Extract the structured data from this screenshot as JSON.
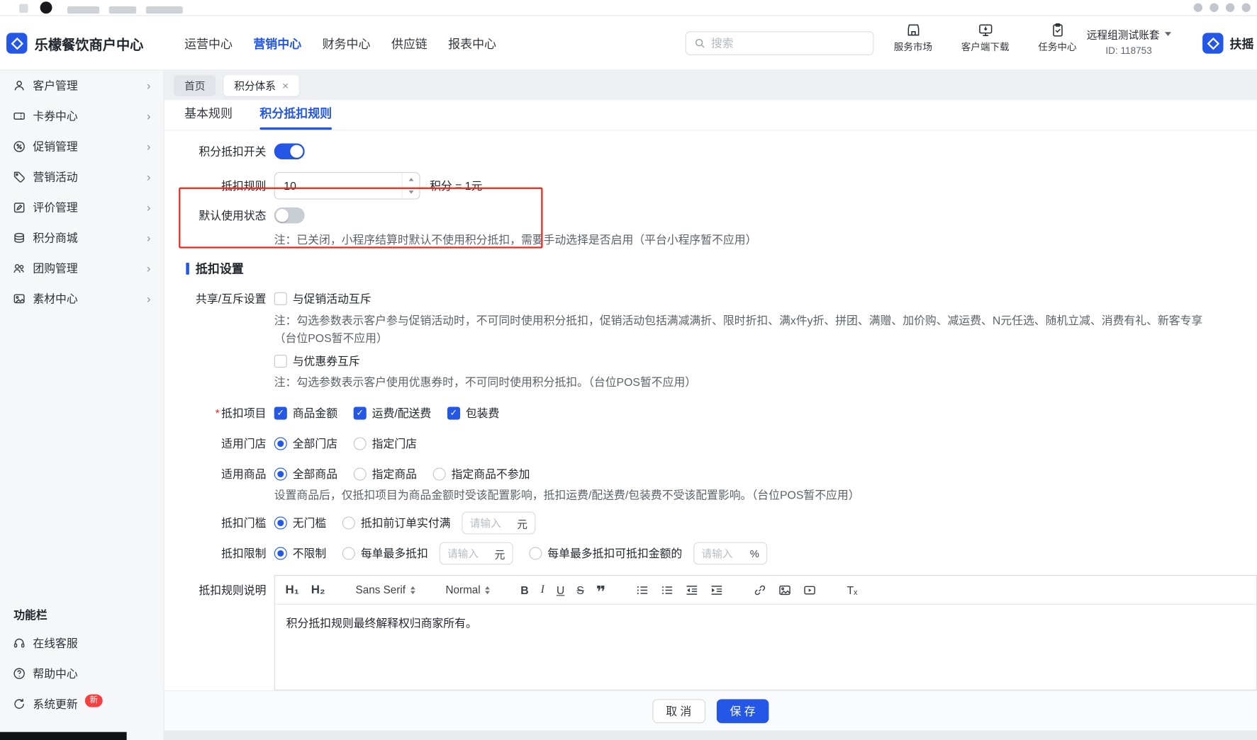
{
  "glyphs": {
    "chevron_right": "›",
    "check": "✓"
  },
  "header": {
    "logo": "乐檬餐饮商户中心",
    "nav": [
      {
        "label": "运营中心"
      },
      {
        "label": "营销中心"
      },
      {
        "label": "财务中心"
      },
      {
        "label": "供应链"
      },
      {
        "label": "报表中心"
      }
    ],
    "search_placeholder": "搜索",
    "actions": [
      {
        "label": "服务市场"
      },
      {
        "label": "客户端下载"
      },
      {
        "label": "任务中心"
      }
    ],
    "account_name": "远程组测试账套",
    "account_id": "ID: 118753",
    "user_name": "扶摇"
  },
  "sidebar": {
    "items": [
      {
        "label": "客户管理"
      },
      {
        "label": "卡券中心"
      },
      {
        "label": "促销管理"
      },
      {
        "label": "营销活动"
      },
      {
        "label": "评价管理"
      },
      {
        "label": "积分商城"
      },
      {
        "label": "团购管理"
      },
      {
        "label": "素材中心"
      }
    ],
    "section": "功能栏",
    "footer_items": [
      {
        "label": "在线客服"
      },
      {
        "label": "帮助中心"
      },
      {
        "label": "系统更新",
        "badge": "新"
      }
    ]
  },
  "tabs_row": {
    "home": "首页",
    "active": "积分体系",
    "close": "×"
  },
  "page_tabs": [
    {
      "label": "基本规则"
    },
    {
      "label": "积分抵扣规则"
    }
  ],
  "form": {
    "switch_label": "积分抵扣开关",
    "rule_label": "抵扣规则",
    "rule_value": "10",
    "rule_suffix": "积分 = 1元",
    "default_label": "默认使用状态",
    "default_note": "注：已关闭，小程序结算时默认不使用积分抵扣，需要手动选择是否启用（平台小程序暂不应用）",
    "section_title": "抵扣设置",
    "share_label": "共享/互斥设置",
    "promo_option": "与促销活动互斥",
    "promo_note": "注：勾选参数表示客户参与促销活动时，不可同时使用积分抵扣，促销活动包括满减满折、限时折扣、满x件y折、拼团、满赠、加价购、减运费、N元任选、随机立减、消费有礼、新客专享",
    "promo_note2": "（台位POS暂不应用）",
    "coupon_option": "与优惠券互斥",
    "coupon_note": "注：勾选参数表示客户使用优惠券时，不可同时使用积分抵扣。（台位POS暂不应用）",
    "items_label": "抵扣项目",
    "items_required": "*",
    "item_options": [
      {
        "label": "商品金额"
      },
      {
        "label": "运费/配送费"
      },
      {
        "label": "包装费"
      }
    ],
    "stores_label": "适用门店",
    "store_options": [
      {
        "label": "全部门店"
      },
      {
        "label": "指定门店"
      }
    ],
    "products_label": "适用商品",
    "product_options": [
      {
        "label": "全部商品"
      },
      {
        "label": "指定商品"
      },
      {
        "label": "指定商品不参加"
      }
    ],
    "products_note": "设置商品后，仅抵扣项目为商品金额时受该配置影响，抵扣运费/配送费/包装费不受该配置影响。（台位POS暂不应用）",
    "threshold_label": "抵扣门槛",
    "threshold_opt1": "无门槛",
    "threshold_opt2": "抵扣前订单实付满",
    "input_placeholder": "请输入",
    "unit_yuan": "元",
    "unit_percent": "%",
    "limit_label": "抵扣限制",
    "limit_opt1": "不限制",
    "limit_opt2": "每单最多抵扣",
    "limit_opt3": "每单最多抵扣可抵扣金额的",
    "desc_label": "抵扣规则说明"
  },
  "editor": {
    "h1": "H₁",
    "h2": "H₂",
    "font": "Sans Serif",
    "size": "Normal",
    "bold": "B",
    "italic": "I",
    "underline": "U",
    "strike": "S",
    "quote": "❞",
    "clean": "Tₓ",
    "content": "积分抵扣规则最终解释权归商家所有。"
  },
  "footer": {
    "cancel": "取 消",
    "save": "保 存"
  }
}
